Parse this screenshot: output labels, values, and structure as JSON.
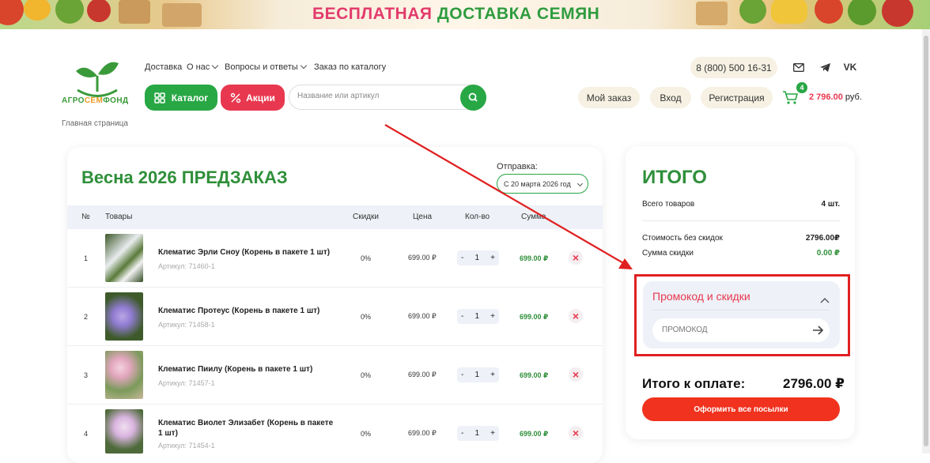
{
  "banner": {
    "text_pink": "БЕСПЛАТНАЯ",
    "text_green": "ДОСТАВКА СЕМЯН"
  },
  "logo": {
    "part1": "АГРО",
    "part2": "СЕМ",
    "part3": "ФОНД"
  },
  "breadcrumb": "Главная страница",
  "nav": {
    "items": [
      {
        "label": "Доставка"
      },
      {
        "label": "О нас"
      },
      {
        "label": "Вопросы и ответы"
      },
      {
        "label": "Заказ по каталогу"
      }
    ]
  },
  "catalog_button": "Каталог",
  "sale_button": "Акции",
  "search": {
    "placeholder": "Название или артикул",
    "value": ""
  },
  "phone": "8 (800) 500 16-31",
  "header_buttons": {
    "my_order": "Мой заказ",
    "login": "Вход",
    "register": "Регистрация"
  },
  "cart": {
    "count": "4",
    "amount": "2 796.00",
    "currency": "руб."
  },
  "order": {
    "title": "Весна 2026 ПРЕДЗАКАЗ",
    "ship_label": "Отправка:",
    "ship_value": "С 20 марта 2026 год",
    "columns": {
      "num": "№",
      "goods": "Товары",
      "discount": "Скидки",
      "price": "Цена",
      "qty": "Кол-во",
      "sum": "Сумма"
    },
    "rows": [
      {
        "num": "1",
        "name": "Клематис Эрли Сноу (Корень в пакете 1 шт)",
        "name2": "",
        "sku": "Артикул: 71460-1",
        "discount": "0%",
        "price": "699.00 ₽",
        "qty": "1",
        "sum": "699.00 ₽"
      },
      {
        "num": "2",
        "name": "Клематис Протеус (Корень в пакете 1 шт)",
        "name2": "",
        "sku": "Артикул: 71458-1",
        "discount": "0%",
        "price": "699.00 ₽",
        "qty": "1",
        "sum": "699.00 ₽"
      },
      {
        "num": "3",
        "name": "Клематис Пиилу (Корень в пакете 1 шт)",
        "name2": "",
        "sku": "Артикул: 71457-1",
        "discount": "0%",
        "price": "699.00 ₽",
        "qty": "1",
        "sum": "699.00 ₽"
      },
      {
        "num": "4",
        "name": "Клематис Виолет Элизабет (Корень в пакете",
        "name2": "1 шт)",
        "sku": "Артикул: 71454-1",
        "discount": "0%",
        "price": "699.00 ₽",
        "qty": "1",
        "sum": "699.00 ₽"
      }
    ],
    "qty_minus": "-",
    "qty_plus": "+"
  },
  "summary": {
    "title": "ИТОГО",
    "total_items_label": "Всего товаров",
    "total_items_value": "4 шт.",
    "cost_label": "Стоимость без скидок",
    "cost_value": "2796.00₽",
    "discount_label": "Сумма скидки",
    "discount_value": "0.00 ₽",
    "promo_title": "Промокод и скидки",
    "promo_placeholder": "ПРОМОКОД",
    "pay_label": "Итого к оплате:",
    "pay_value": "2796.00 ₽",
    "checkout_button": "Оформить все посылки"
  },
  "colors": {
    "green": "#28a745",
    "red": "#e8384f",
    "annotation": "#e02020"
  }
}
